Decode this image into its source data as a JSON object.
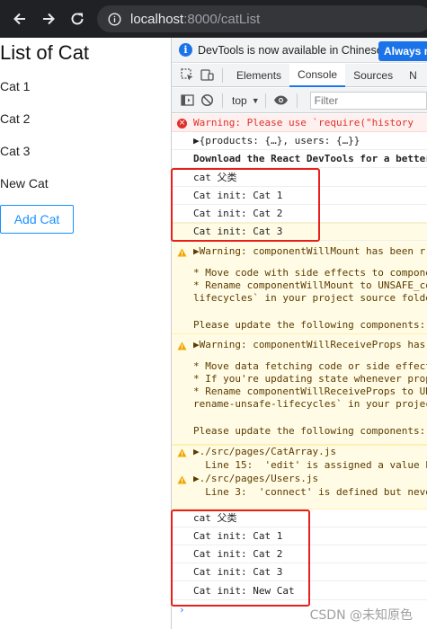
{
  "browser": {
    "url_host": "localhost",
    "url_rest": ":8000/catList",
    "back_icon": "back-arrow-icon",
    "forward_icon": "forward-arrow-icon",
    "reload_icon": "reload-icon",
    "info_icon": "site-info-icon"
  },
  "page": {
    "title": "List of Cat",
    "cats": [
      "Cat 1",
      "Cat 2",
      "Cat 3",
      "New Cat"
    ],
    "add_button": "Add Cat",
    "accent": "#1890ff"
  },
  "devtools": {
    "infobar": {
      "icon_text": "i",
      "text": "DevTools is now available in Chinese!",
      "button": "Always m"
    },
    "tabs": [
      "Elements",
      "Console",
      "Sources",
      "N"
    ],
    "active_tab": "Console",
    "toolbar": {
      "context": "top",
      "filter_placeholder": "Filter"
    },
    "messages": [
      {
        "type": "err",
        "text": "Warning: Please use `require(\"history"
      },
      {
        "type": "log",
        "text": "▶{products: {…}, users: {…}}"
      },
      {
        "type": "dark",
        "text": "Download the React DevTools for a better"
      },
      {
        "type": "log",
        "text": "cat 父类"
      },
      {
        "type": "log",
        "text": "Cat init: Cat 1"
      },
      {
        "type": "log",
        "text": "Cat init: Cat 2"
      },
      {
        "type": "log",
        "text": "Cat init: Cat 3"
      },
      {
        "type": "warn",
        "text": "▶Warning: componentWillMount has been r"
      },
      {
        "type": "warn-body",
        "text": "* Move code with side effects to compone"
      },
      {
        "type": "warn-body",
        "text": "* Rename componentWillMount to UNSAFE_co"
      },
      {
        "type": "warn-body",
        "text": "lifecycles` in your project source folde"
      },
      {
        "type": "warn-body",
        "text": "Please update the following components: "
      },
      {
        "type": "warn",
        "text": "▶Warning: componentWillReceiveProps has"
      },
      {
        "type": "warn-body",
        "text": "* Move data fetching code or side effect"
      },
      {
        "type": "warn-body",
        "text": "* If you're updating state whenever prop"
      },
      {
        "type": "warn-body",
        "text": "* Rename componentWillReceiveProps to UN"
      },
      {
        "type": "warn-body",
        "text": "rename-unsafe-lifecycles` in your projec"
      },
      {
        "type": "warn-body",
        "text": "Please update the following components: "
      },
      {
        "type": "warn",
        "text": "▶./src/pages/CatArray.js"
      },
      {
        "type": "warn-body",
        "text": "  Line 15:  'edit' is assigned a value b"
      },
      {
        "type": "warn",
        "text": "▶./src/pages/Users.js"
      },
      {
        "type": "warn-body",
        "text": "  Line 3:  'connect' is defined but neve"
      },
      {
        "type": "log",
        "text": "cat 父类"
      },
      {
        "type": "log",
        "text": "Cat init: Cat 1"
      },
      {
        "type": "log",
        "text": "Cat init: Cat 2"
      },
      {
        "type": "log",
        "text": "Cat init: Cat 3"
      },
      {
        "type": "log",
        "text": "Cat init: New Cat"
      }
    ]
  },
  "watermark": "CSDN @未知原色",
  "highlight_color": "#e8201c"
}
